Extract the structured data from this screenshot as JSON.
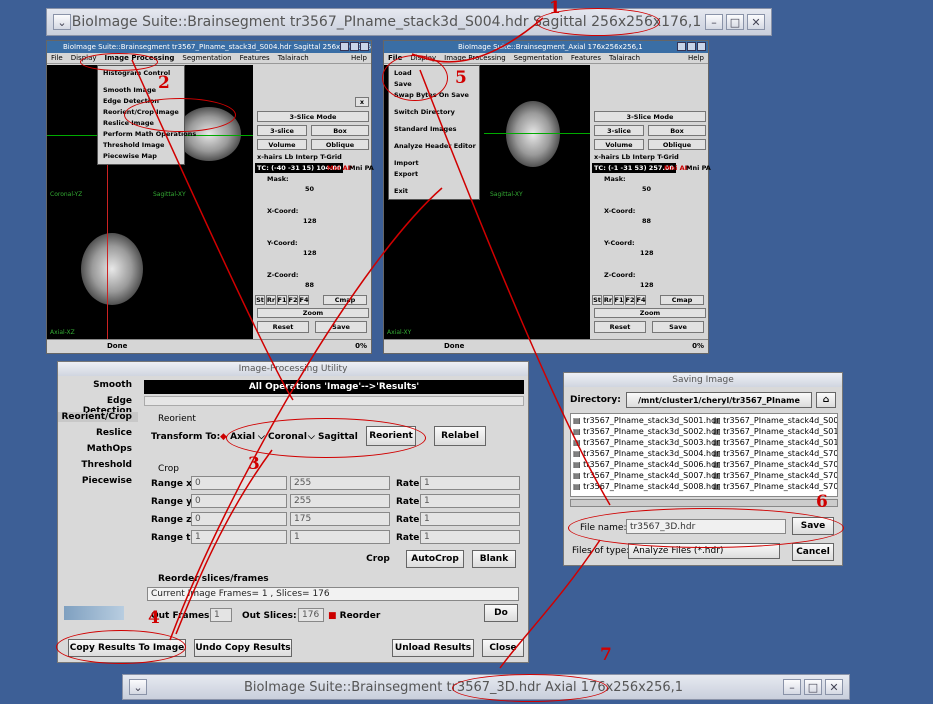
{
  "top_title": "BioImage Suite::Brainsegment tr3567_PIname_stack3d_S004.hdr Sagittal 256x256x176,1",
  "bottom_title": "BioImage Suite::Brainsegment tr3567_3D.hdr Axial 176x256x256,1",
  "left_window": {
    "title": "BioImage Suite::Brainsegment tr3567_PIname_stack3d_S004.hdr Sagittal 256x256x176,1",
    "menu": [
      "File",
      "Display",
      "Image Processing",
      "Segmentation",
      "Features",
      "Talairach",
      "Help"
    ],
    "dropdown": [
      "Histogram Control",
      "Smooth Image",
      "Edge Detection",
      "Reorient/Crop Image",
      "Reslice Image",
      "Perform Math Operations",
      "Threshold Image",
      "Piecewise Map"
    ],
    "view_labels": [
      "Coronal-YZ",
      "Sagittal-XY",
      "Axial-XZ"
    ],
    "status": "Done",
    "pct": "0%"
  },
  "right_window": {
    "title": "BioImage Suite::Brainsegment_Axial 176x256x256,1",
    "menu": [
      "File",
      "Display",
      "Image Processing",
      "Segmentation",
      "Features",
      "Talairach",
      "Help"
    ],
    "dropdown": [
      "Load",
      "Save",
      "Swap Bytes On Save",
      "Switch Directory",
      "Standard Images",
      "Analyze Header Editor",
      "Import",
      "Export",
      "Exit"
    ],
    "view_labels": [
      "Sagittal-XY",
      "Axial-XY"
    ],
    "status": "Done",
    "pct": "0%"
  },
  "panel": {
    "mode": "3-Slice Mode",
    "slice": "3-slice",
    "box": "Box",
    "volume": "Volume",
    "oblique": "Oblique",
    "checks": "x-hairs  Lb  Interp  T-Grid",
    "tc_left": "TC: (-40 -31 15) 104.00",
    "tc_right": "TC: (-1 -31 53) 257.00",
    "mni_ap": "Mni AP",
    "mni_pa": "Mni PA",
    "mask": "Mask:",
    "mask_val": "50",
    "xcoord": "X-Coord:",
    "ycoord": "Y-Coord:",
    "zcoord": "Z-Coord:",
    "x_left": "128",
    "y_left": "128",
    "z_left": "88",
    "x_right": "88",
    "y_right": "128",
    "z_right": "128",
    "fkeys": [
      "St",
      "Rr",
      "F1",
      "F2",
      "F4"
    ],
    "cmap": "Cmap",
    "zoom": "Zoom",
    "reset": "Reset",
    "save": "Save"
  },
  "ipu": {
    "title": "Image-Processing Utility",
    "sidebar": [
      "Smooth",
      "Edge Detection",
      "Reorient/Crop",
      "Reslice",
      "MathOps",
      "Threshold",
      "Piecewise"
    ],
    "header": "All Operations 'Image'-->'Results'",
    "reorient_label": "Reorient",
    "transform_label": "Transform To:",
    "options": [
      "Axial",
      "Coronal",
      "Sagittal"
    ],
    "reorient_btn": "Reorient",
    "relabel_btn": "Relabel",
    "crop_label": "Crop",
    "ranges": [
      {
        "label": "Range x:",
        "a": "0",
        "b": "255",
        "rate": "1"
      },
      {
        "label": "Range y:",
        "a": "0",
        "b": "255",
        "rate": "1"
      },
      {
        "label": "Range z:",
        "a": "0",
        "b": "175",
        "rate": "1"
      },
      {
        "label": "Range t:",
        "a": "1",
        "b": "1",
        "rate": "1"
      }
    ],
    "rate_label": "Rate",
    "crop_btn": "Crop",
    "autocrop_btn": "AutoCrop",
    "blank_btn": "Blank",
    "reorder_label": "Reorder slices/frames",
    "current": "Current Image Frames= 1 , Slices= 176",
    "out_frames_label": "Out Frames:",
    "out_frames": "1",
    "out_slices_label": "Out Slices:",
    "out_slices": "176",
    "reorder_chk": "Reorder",
    "do_btn": "Do",
    "copy_btn": "Copy Results To Image",
    "undo_btn": "Undo Copy Results",
    "unload_btn": "Unload Results",
    "close_btn": "Close"
  },
  "saving": {
    "title": "Saving Image",
    "dir_label": "Directory:",
    "dir": "/mnt/cluster1/cheryl/tr3567_PIname",
    "files_col1": [
      "tr3567_PIname_stack3d_S001.hdr",
      "tr3567_PIname_stack3d_S002.hdr",
      "tr3567_PIname_stack3d_S003.hdr",
      "tr3567_PIname_stack3d_S004.hdr",
      "tr3567_PIname_stack4d_S006.hdr",
      "tr3567_PIname_stack4d_S007.hdr",
      "tr3567_PIname_stack4d_S008.hdr"
    ],
    "files_col2": [
      "tr3567_PIname_stack4d_S009",
      "tr3567_PIname_stack4d_S010",
      "tr3567_PIname_stack4d_S011",
      "tr3567_PIname_stack4d_S706",
      "tr3567_PIname_stack4d_S707",
      "tr3567_PIname_stack4d_S708",
      "tr3567_PIname_stack4d_S709"
    ],
    "fname_label": "File name:",
    "fname": "tr3567_3D.hdr",
    "save_btn": "Save",
    "type_label": "Files of type:",
    "type": "Analyze Files (*.hdr)",
    "cancel_btn": "Cancel"
  },
  "annotations": [
    "1",
    "2",
    "3",
    "4",
    "5",
    "6",
    "7"
  ],
  "colors": {
    "annotation": "#d00000",
    "desktop": "#3d5f96",
    "titlebar": "#3a6ea5"
  }
}
